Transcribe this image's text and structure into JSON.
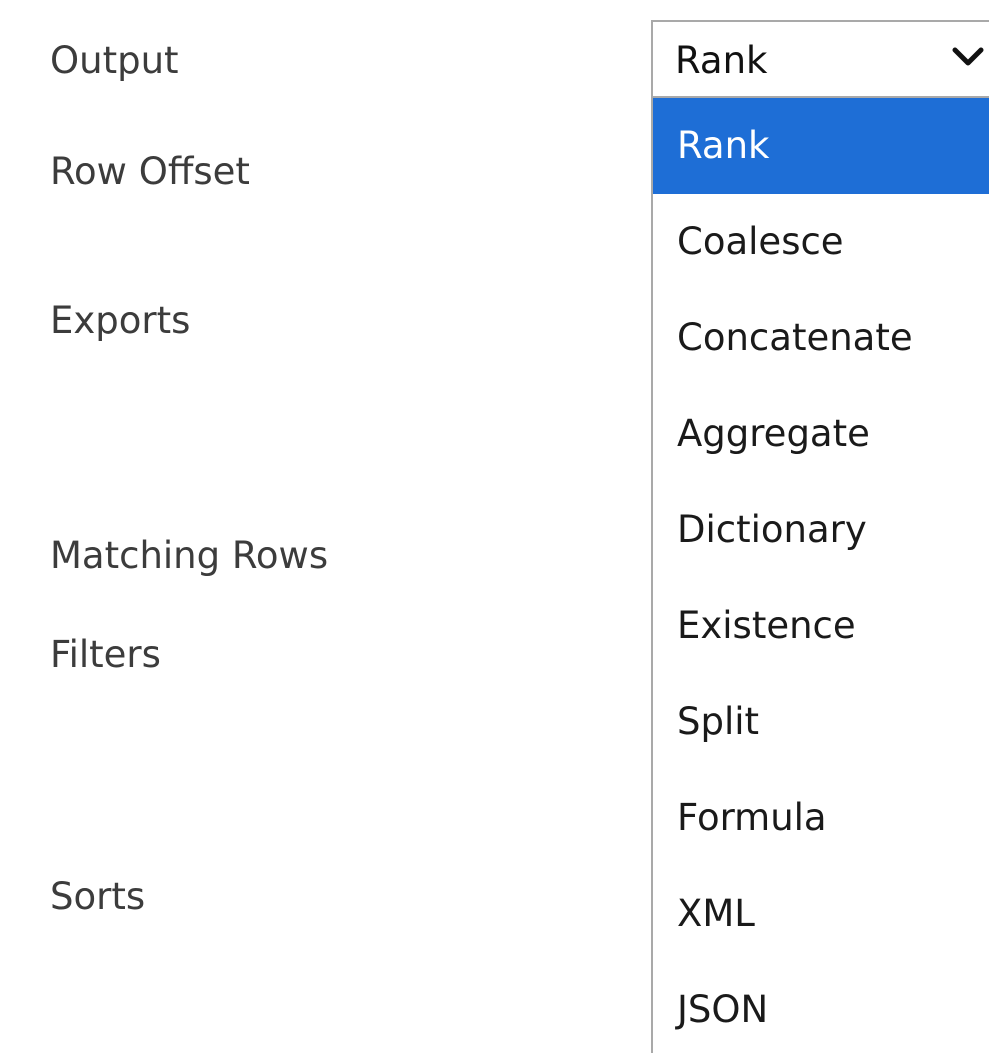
{
  "form": {
    "labels": [
      "Output",
      "Row Offset",
      "Exports",
      "Matching Rows",
      "Filters",
      "Sorts"
    ]
  },
  "output_select": {
    "value": "Rank",
    "icon": "chevron-down-icon",
    "options": [
      "Rank",
      "Coalesce",
      "Concatenate",
      "Aggregate",
      "Dictionary",
      "Existence",
      "Split",
      "Formula",
      "XML",
      "JSON"
    ],
    "selected_index": 0
  },
  "colors": {
    "selected_background": "#1e6ed6",
    "selected_text": "#ffffff",
    "border": "#a9a9a9"
  }
}
